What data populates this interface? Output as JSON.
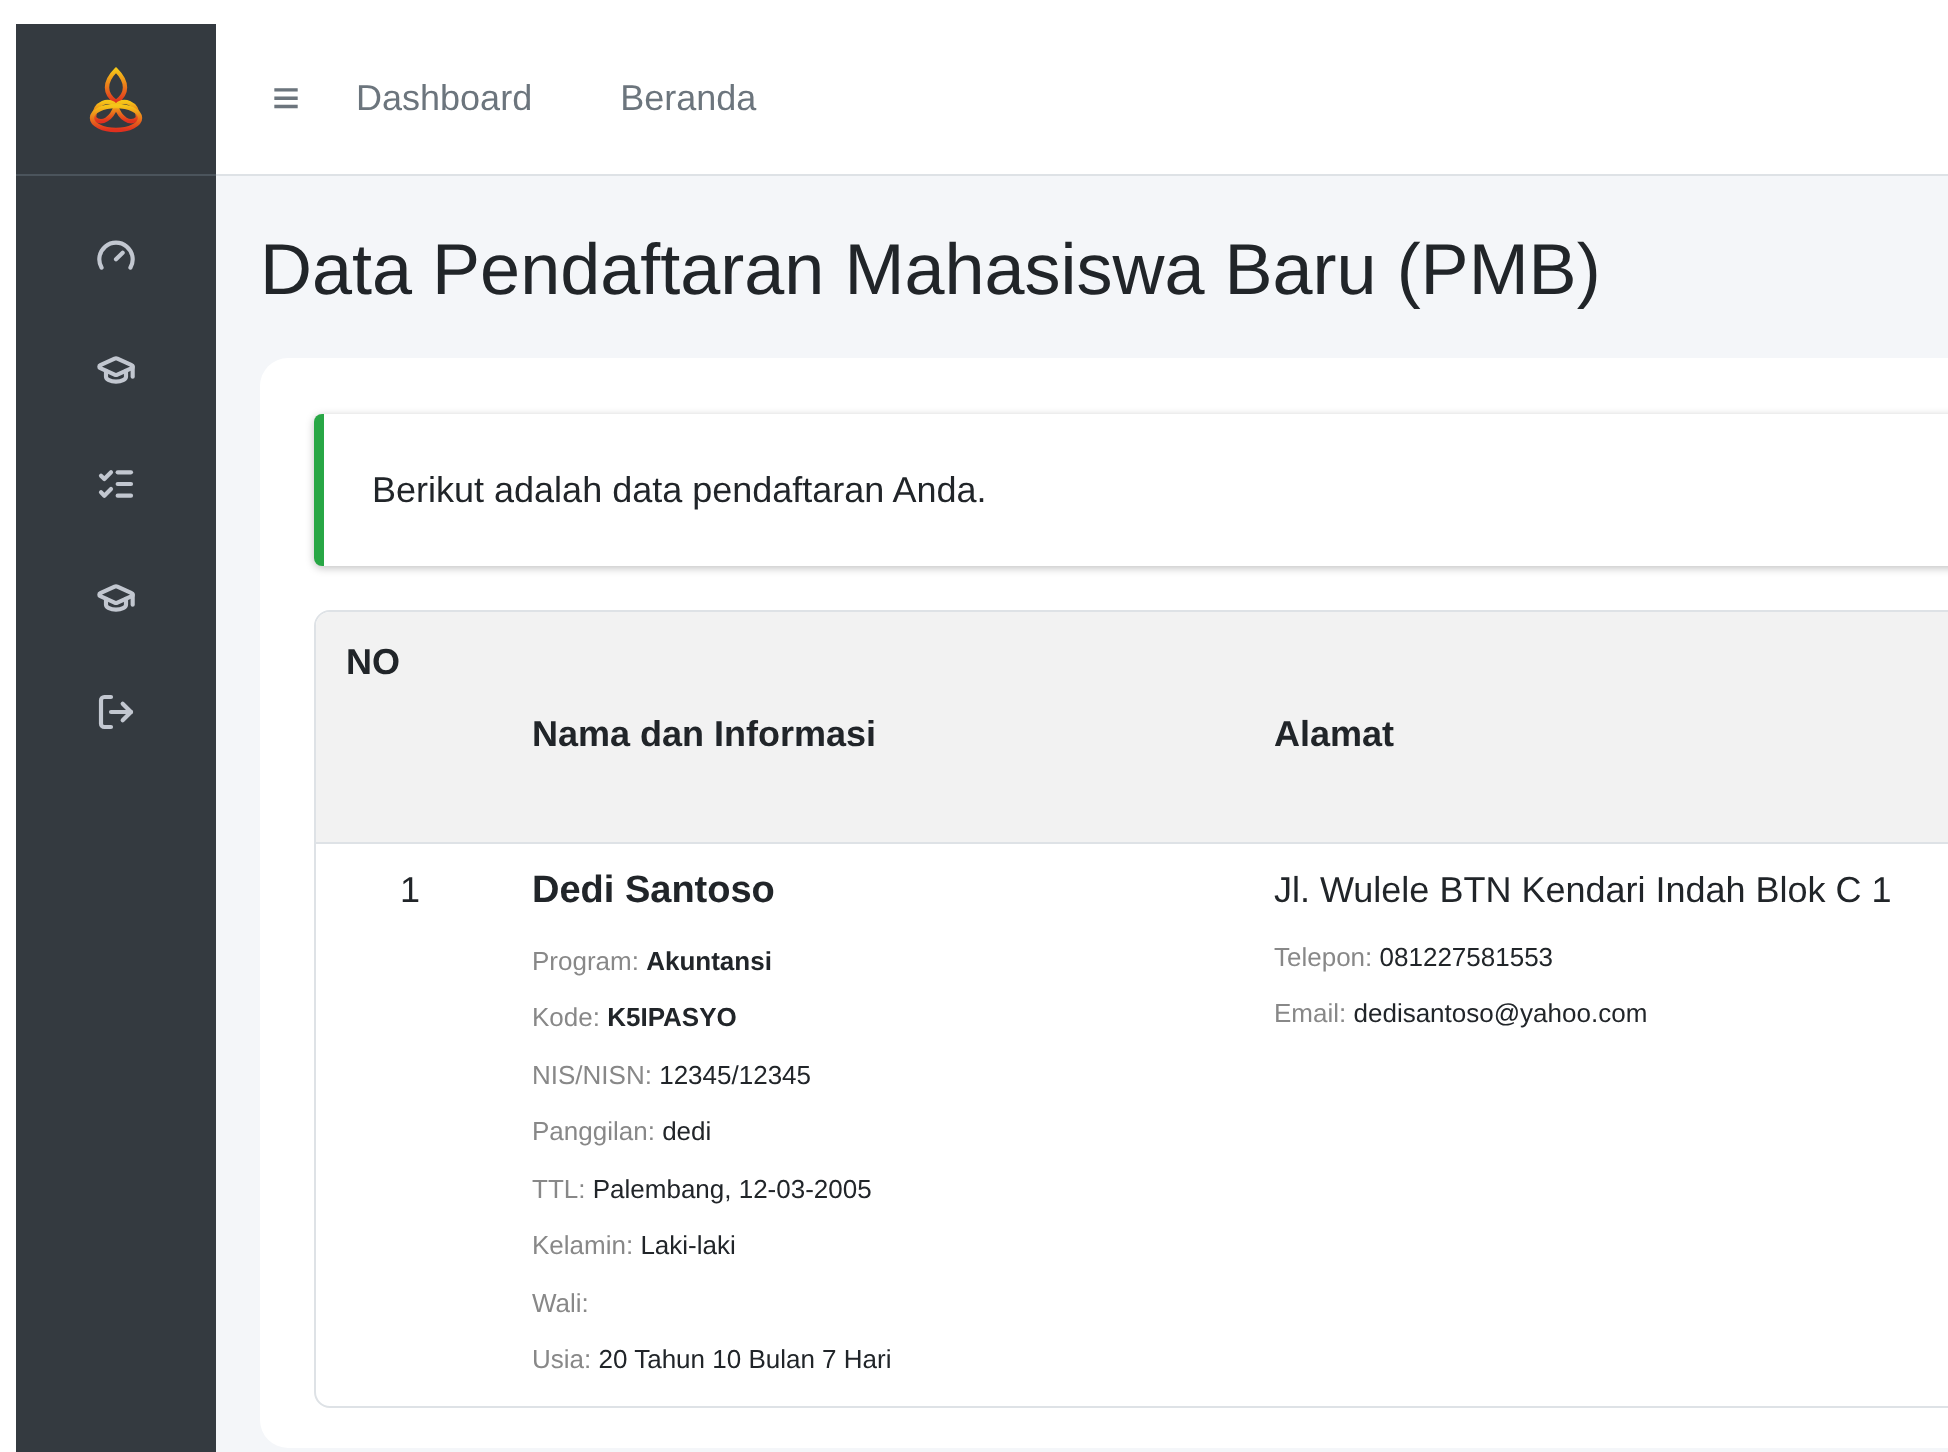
{
  "sidebar": {
    "items": [
      {
        "kind": "dashboard"
      },
      {
        "kind": "graduation"
      },
      {
        "kind": "checklist"
      },
      {
        "kind": "graduation"
      },
      {
        "kind": "logout"
      }
    ]
  },
  "navbar": {
    "menu_icon": "≡",
    "links": [
      "Dashboard",
      "Beranda"
    ]
  },
  "page_title": "Data Pendaftaran Mahasiswa Baru (PMB)",
  "alert": {
    "text": "Berikut adalah data pendaftaran Anda."
  },
  "table": {
    "columns": [
      "NO",
      "Nama dan Informasi",
      "Alamat"
    ],
    "rows": [
      {
        "no": "1",
        "name": "Dedi Santoso",
        "details": [
          {
            "label": "Program:",
            "value": "Akuntansi",
            "bold": true
          },
          {
            "label": "Kode:",
            "value": "K5IPASYO",
            "bold": true
          },
          {
            "label": "NIS/NISN:",
            "value": "12345/12345",
            "bold": false
          },
          {
            "label": "Panggilan:",
            "value": "dedi",
            "bold": false
          },
          {
            "label": "TTL:",
            "value": "Palembang, 12-03-2005",
            "bold": false
          },
          {
            "label": "Kelamin:",
            "value": "Laki-laki",
            "bold": false
          },
          {
            "label": "Wali:"
          },
          {
            "label": "Usia:",
            "value": "20 Tahun 10 Bulan 7 Hari",
            "bold": false
          }
        ],
        "address": "Jl. Wulele BTN Kendari Indah Blok C 1",
        "contacts": [
          {
            "label": "Telepon:",
            "value": "081227581553"
          },
          {
            "label": "Email:",
            "value": "dedisantoso@yahoo.com"
          }
        ]
      }
    ]
  }
}
